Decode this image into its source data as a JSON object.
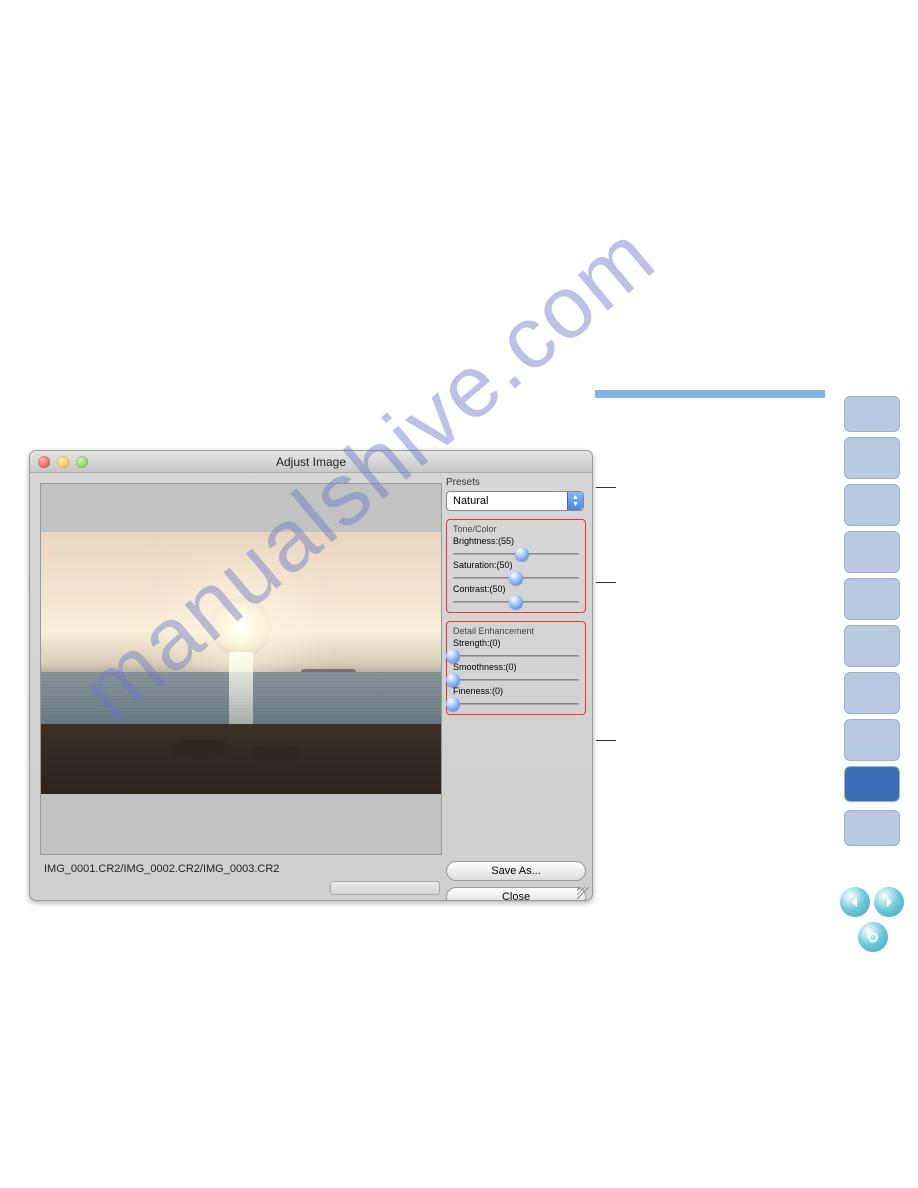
{
  "watermark": "manualshive.com",
  "window": {
    "title": "Adjust Image",
    "filenames": "IMG_0001.CR2/IMG_0002.CR2/IMG_0003.CR2"
  },
  "panel": {
    "presets_label": "Presets",
    "presets_value": "Natural",
    "tone": {
      "title": "Tone/Color",
      "brightness": {
        "label": "Brightness:(55)",
        "value": 55
      },
      "saturation": {
        "label": "Saturation:(50)",
        "value": 50
      },
      "contrast": {
        "label": "Contrast:(50)",
        "value": 50
      }
    },
    "detail": {
      "title": "Detail Enhancement",
      "strength": {
        "label": "Strength:(0)",
        "value": 0
      },
      "smoothness": {
        "label": "Smoothness:(0)",
        "value": 0
      },
      "fineness": {
        "label": "Fineness:(0)",
        "value": 0
      }
    },
    "buttons": {
      "save_as": "Save As...",
      "close": "Close"
    }
  },
  "chart_data": {
    "type": "table",
    "title": "Adjust Image slider values",
    "categories": [
      "Brightness",
      "Saturation",
      "Contrast",
      "Strength",
      "Smoothness",
      "Fineness"
    ],
    "values": [
      55,
      50,
      50,
      0,
      0,
      0
    ]
  }
}
